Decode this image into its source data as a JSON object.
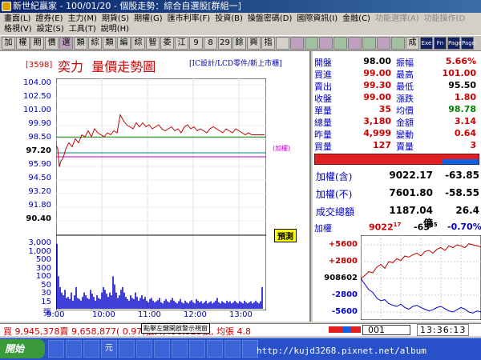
{
  "window": {
    "title": "新世紀贏家 - 100/01/20 - 個股走勢：綜合自選股[群組一]"
  },
  "menu": {
    "row1": [
      "畫面(L)",
      "證券(E)",
      "主力(M)",
      "期貨(S)",
      "期權(G)",
      "匯市利率(F)",
      "投資(B)",
      "操盤密碼(D)",
      "國際資訊(I)",
      "金融(C)",
      "功能選擇(A)",
      "功能操作(D"
    ],
    "row2": [
      "格視(V)",
      "設定(S)",
      "工具(T)",
      "說明(H)"
    ]
  },
  "toolbar": {
    "buttons": [
      "加",
      "權",
      "期",
      "價",
      "選",
      "類",
      "綜",
      "類",
      "編",
      "綜",
      "智",
      "委",
      "江",
      "9",
      "8",
      "29",
      "餘",
      "興",
      "指",
      "",
      "",
      "",
      "",
      "",
      "",
      "",
      "",
      "",
      "成",
      "Exe",
      "Fn",
      "Page",
      "Page"
    ]
  },
  "stock": {
    "code": "[3598]",
    "name": "奕力",
    "chart_title": "量價走勢圖",
    "subtitle": "[IC設計/LCD零件/新上市櫃]",
    "index_line_label": "(加權)",
    "forecast_label": "預測"
  },
  "price_axis": [
    "104.00",
    "102.50",
    "101.00",
    "99.90",
    "98.50",
    "97.20",
    "95.90",
    "94.50",
    "93.20",
    "91.80",
    "90.40"
  ],
  "vol_axis": [
    "3,000",
    "1,000",
    "500",
    "300",
    "100",
    "50",
    "30",
    "15",
    "張"
  ],
  "time_axis": [
    "9:00",
    "10:00",
    "11:00",
    "12:00",
    "13:00"
  ],
  "quote": {
    "rows": [
      {
        "l1": "開盤",
        "v1": "98.00",
        "l2": "振幅",
        "v2": "5.66%",
        "c1": "blk",
        "c2": "red"
      },
      {
        "l1": "買進",
        "v1": "99.00",
        "l2": "最高",
        "v2": "101.00",
        "c1": "red",
        "c2": "red"
      },
      {
        "l1": "賣出",
        "v1": "99.30",
        "l2": "最低",
        "v2": "95.50",
        "c1": "red",
        "c2": "blk"
      },
      {
        "l1": "收盤",
        "v1": "99.00",
        "l2": "漲跌",
        "v2": "1.80",
        "c1": "red",
        "c2": "red"
      },
      {
        "l1": "單量",
        "v1": "35",
        "l2": "均價",
        "v2": "98.78",
        "c1": "red",
        "c2": "grn"
      },
      {
        "l1": "總量",
        "v1": "3,180",
        "l2": "金額",
        "v2": "3.14",
        "c1": "red",
        "c2": "red"
      },
      {
        "l1": "昨量",
        "v1": "4,999",
        "l2": "變動",
        "v2": "0.64",
        "c1": "red",
        "c2": "red"
      },
      {
        "l1": "買量",
        "v1": "127",
        "l2": "賣量",
        "v2": "3",
        "c1": "red",
        "c2": "red"
      }
    ]
  },
  "index": {
    "rows": [
      {
        "label": "加權(含)",
        "value": "9022.17",
        "change": "-63.85"
      },
      {
        "label": "加權(不)",
        "value": "7601.80",
        "change": "-58.55"
      },
      {
        "label": "成交總額",
        "value": "1187.04億",
        "change": "26.4"
      }
    ]
  },
  "mini": {
    "label": "加權",
    "value": "9022",
    "value_sup": "17",
    "change": "-63",
    "change_sup": "85",
    "pct": "-0.70%",
    "axis": [
      "+5600",
      "+2800",
      "908602",
      "-2800",
      "-5600"
    ]
  },
  "status": {
    "text": "買 9,945,378賣 9,658,877( 0.97)張,4,490,925張, 均張 4.8",
    "tooltip": "點擊左鍵開啟警示視窗",
    "code_value": "001",
    "clock": "13:36:13"
  },
  "taskbar": {
    "start": "開始",
    "tasks": [
      "",
      "",
      "",
      "元",
      "",
      "",
      "",
      "",
      "",
      "",
      "",
      ""
    ],
    "watermark": "http://kujd3268.pixnet.net/album"
  },
  "colors": {
    "price_line": "#c00000",
    "index_line": "#c000c0",
    "avg_line": "#008000",
    "volume_bar": "#0000cc",
    "ref_line": "#008080"
  },
  "chart_data": {
    "type": "line",
    "price_x": [
      0,
      2,
      4,
      6,
      8,
      10,
      12,
      16,
      20,
      24,
      28,
      32,
      36,
      40,
      44,
      48,
      52,
      56,
      60,
      64,
      68,
      72,
      76,
      80,
      84,
      88,
      92,
      96,
      100,
      104,
      108,
      112,
      116,
      120,
      124,
      128,
      132,
      136,
      140,
      144,
      148,
      152,
      156,
      160,
      164,
      168,
      172,
      176,
      180,
      184,
      188,
      192,
      196,
      200,
      204,
      208,
      212,
      216,
      220,
      224,
      228,
      232,
      236,
      240,
      244,
      248,
      252,
      256,
      260
    ],
    "price_y": [
      98.0,
      97.6,
      95.8,
      96.4,
      96.6,
      97.0,
      97.6,
      98.2,
      97.8,
      98.6,
      98.2,
      99.0,
      98.8,
      99.4,
      98.8,
      99.6,
      99.2,
      99.0,
      98.8,
      99.2,
      99.0,
      99.4,
      99.2,
      101.0,
      100.4,
      100.0,
      99.8,
      99.6,
      100.2,
      99.8,
      100.2,
      99.8,
      100.0,
      99.6,
      99.8,
      100.0,
      99.6,
      99.4,
      99.6,
      99.8,
      99.4,
      99.6,
      99.2,
      99.8,
      100.0,
      99.6,
      99.8,
      99.4,
      99.6,
      99.4,
      99.2,
      99.6,
      99.8,
      99.6,
      99.4,
      99.2,
      99.6,
      99.4,
      99.2,
      99.6,
      99.4,
      99.2,
      99.0,
      99.2,
      99.0,
      99.0,
      99.0,
      99.0,
      99.0
    ],
    "index_y": 96.8,
    "ref_price": 97.2,
    "avg_price": 98.78,
    "vol_x": [
      1,
      3,
      5,
      7,
      9,
      11,
      13,
      15,
      17,
      19,
      21,
      23,
      25,
      27,
      29,
      31,
      33,
      35,
      37,
      39,
      41,
      43,
      45,
      47,
      49,
      51,
      53,
      55,
      57,
      59,
      61,
      63,
      65,
      67,
      69,
      71,
      73,
      75,
      77,
      79,
      81,
      83,
      85,
      87,
      89,
      91,
      93,
      95,
      97,
      99,
      101,
      103,
      105,
      107,
      109,
      111,
      113,
      115,
      117,
      119,
      121,
      123,
      125,
      127,
      129,
      131,
      133,
      135,
      137,
      139,
      141,
      143,
      145,
      147,
      149,
      151,
      153,
      155,
      157,
      159,
      161,
      163,
      165,
      167,
      169,
      171,
      173,
      175,
      177,
      179,
      181,
      183,
      185,
      187,
      189,
      191,
      193,
      195,
      197,
      199,
      201,
      203,
      205,
      207,
      209,
      211,
      213,
      215,
      217,
      219,
      221,
      223,
      225,
      227,
      229,
      231,
      233,
      235,
      237,
      239,
      241,
      243,
      245,
      247,
      249,
      251,
      253,
      255,
      257
    ],
    "vol_v": [
      120,
      60,
      40,
      30,
      25,
      35,
      20,
      22,
      18,
      30,
      15,
      25,
      40,
      20,
      18,
      15,
      22,
      30,
      25,
      20,
      18,
      35,
      28,
      22,
      15,
      25,
      20,
      18,
      30,
      40,
      35,
      28,
      22,
      30,
      25,
      60,
      45,
      30,
      20,
      25,
      35,
      40,
      30,
      22,
      18,
      15,
      25,
      20,
      18,
      30,
      22,
      15,
      20,
      25,
      18,
      22,
      15,
      12,
      18,
      20,
      15,
      12,
      14,
      16,
      20,
      12,
      10,
      15,
      18,
      14,
      12,
      16,
      20,
      15,
      12,
      10,
      14,
      18,
      12,
      10,
      15,
      12,
      10,
      14,
      16,
      12,
      10,
      18,
      15,
      12,
      14,
      10,
      12,
      15,
      10,
      12,
      14,
      10,
      12,
      15,
      20,
      12,
      10,
      14,
      12,
      10,
      15,
      12,
      14,
      10,
      12,
      15,
      12,
      10,
      14,
      12,
      10,
      15,
      12,
      10,
      12,
      14,
      10,
      12,
      15,
      12,
      10,
      14,
      40
    ],
    "mini_adv": [
      0,
      5,
      12,
      10,
      20,
      25,
      18,
      30,
      28,
      35,
      32,
      40,
      38,
      42,
      45,
      40,
      48,
      50,
      45,
      52,
      55,
      50,
      58,
      55,
      60,
      58,
      55,
      62,
      60,
      58,
      56
    ],
    "mini_dec": [
      0,
      -10,
      -20,
      -25,
      -35,
      -40,
      -38,
      -45,
      -48,
      -50,
      -46,
      -52,
      -55,
      -50,
      -48,
      -52,
      -55,
      -58,
      -56,
      -52,
      -50,
      -54,
      -58,
      -60,
      -56,
      -52,
      -55,
      -60,
      -62,
      -58,
      -60
    ]
  }
}
